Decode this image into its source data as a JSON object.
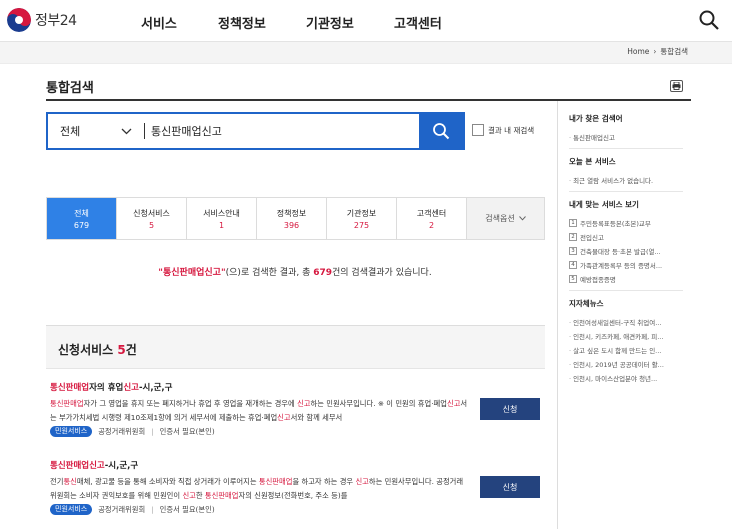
{
  "header": {
    "logo_text": "정부24",
    "nav": [
      "서비스",
      "정책정보",
      "기관정보",
      "고객센터"
    ]
  },
  "breadcrumb": [
    "Home",
    "›",
    "통합검색"
  ],
  "page_title": "통합검색",
  "search": {
    "scope": "전체",
    "query": "통신판매업신고",
    "rescan_label": "결과 내 재검색"
  },
  "tabs": [
    {
      "label": "전체",
      "count": "679",
      "active": true
    },
    {
      "label": "신청서비스",
      "count": "5"
    },
    {
      "label": "서비스안내",
      "count": "1"
    },
    {
      "label": "정책정보",
      "count": "396"
    },
    {
      "label": "기관정보",
      "count": "275"
    },
    {
      "label": "고객센터",
      "count": "2"
    }
  ],
  "tab_options_label": "검색옵션",
  "summary": {
    "keyword": "\"통신판매업신고\"",
    "pre": "(으)로 검색한 결과, 총 ",
    "count": "679",
    "post": "건의 검색결과가 있습니다."
  },
  "section": {
    "title": "신청서비스",
    "count": "5",
    "unit": "건"
  },
  "results": [
    {
      "title_hl": "통신판매업",
      "title_rest": "자의 휴업",
      "title_hl2": "신고",
      "title_rest2": "-시,군,구",
      "desc": [
        {
          "t": "통신판매업",
          "h": true
        },
        {
          "t": "자가 그 영업을 휴지 또는 폐지하거나 휴업 후 영업을 재개하는 경우에 ",
          "h": false
        },
        {
          "t": "신고",
          "h": true
        },
        {
          "t": "하는 민원사무입니다. ※ 이 민원의 휴업·폐업",
          "h": false
        },
        {
          "t": "신고",
          "h": true
        },
        {
          "t": "서는 부가가치세법 시행령 제10조제1항에 의거 세무서에 제출하는 휴업·폐업",
          "h": false
        },
        {
          "t": "신고",
          "h": true
        },
        {
          "t": "서와 함께 세무서",
          "h": false
        }
      ],
      "badge": "민원서비스",
      "agency": "공정거래위원회",
      "auth": "인증서 필요(본인)",
      "button": "신청"
    },
    {
      "title_hl": "통신판매업신고",
      "title_rest": "-시,군,구",
      "title_hl2": "",
      "title_rest2": "",
      "desc": [
        {
          "t": "전기",
          "h": false
        },
        {
          "t": "통신",
          "h": true
        },
        {
          "t": "매체, 광고물 등을 통해 소비자와 직접 상거래가 이루어지는 ",
          "h": false
        },
        {
          "t": "통신판매업",
          "h": true
        },
        {
          "t": "을 하고자 하는 경우 ",
          "h": false
        },
        {
          "t": "신고",
          "h": true
        },
        {
          "t": "하는 민원사무입니다. 공정거래위원회는 소비자 권익보호를 위해 민원인이 ",
          "h": false
        },
        {
          "t": "신고",
          "h": true
        },
        {
          "t": "한 ",
          "h": false
        },
        {
          "t": "통신판매업",
          "h": true
        },
        {
          "t": "자의 신원정보(전화번호, 주소 등)를",
          "h": false
        }
      ],
      "badge": "민원서비스",
      "agency": "공정거래위원회",
      "auth": "인증서 필요(본인)",
      "button": "신청"
    }
  ],
  "sidebar": {
    "my_search": {
      "title": "내가 찾은 검색어",
      "items": [
        "통신판매업신고"
      ]
    },
    "today": {
      "title": "오늘 본 서비스",
      "items": [
        "최근 열람 서비스가 없습니다."
      ]
    },
    "custom": {
      "title": "내게 맞는 서비스 보기",
      "items": [
        "주민등록표등본(초본)교부",
        "전입신고",
        "건축물대장 등·초본 발급(열...",
        "가족관계등록부 등의 증명서...",
        "예방접종증명"
      ]
    },
    "news": {
      "title": "지자체뉴스",
      "items": [
        "인천여성새일센터-구직 취업여...",
        "인천시, 키즈카페, 애견카페, 피...",
        "살고 싶은 도시 함께 만드는 인...",
        "인천시, 2019년 공공데이터 활...",
        "인천시, 마이스산업분야 청년..."
      ]
    }
  },
  "colors": {
    "primary": "#1f64c8",
    "tab_active": "#2f81e6",
    "highlight": "#d6183f",
    "button_dark": "#24437e"
  }
}
